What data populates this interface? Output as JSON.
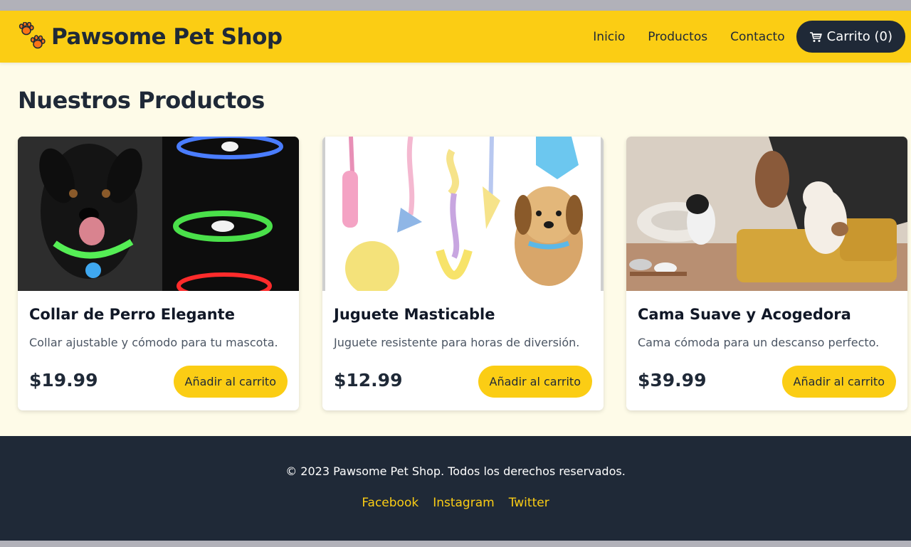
{
  "brand": {
    "name": "Pawsome Pet Shop",
    "icon": "paw-prints-icon"
  },
  "nav": {
    "links": [
      "Inicio",
      "Productos",
      "Contacto"
    ],
    "cart_label": "Carrito (0)",
    "cart_icon": "shopping-cart-icon"
  },
  "main": {
    "title": "Nuestros Productos"
  },
  "products": [
    {
      "name": "Collar de Perro Elegante",
      "description": "Collar ajustable y cómodo para tu mascota.",
      "price": "$19.99",
      "button": "Añadir al carrito"
    },
    {
      "name": "Juguete Masticable",
      "description": "Juguete resistente para horas de diversión.",
      "price": "$12.99",
      "button": "Añadir al carrito"
    },
    {
      "name": "Cama Suave y Acogedora",
      "description": "Cama cómoda para un descanso perfecto.",
      "price": "$39.99",
      "button": "Añadir al carrito"
    }
  ],
  "footer": {
    "copyright": "© 2023 Pawsome Pet Shop. Todos los derechos reservados.",
    "social": [
      "Facebook",
      "Instagram",
      "Twitter"
    ]
  },
  "colors": {
    "accent": "#fbcd14",
    "dark": "#1f2937",
    "background": "#fefbe8"
  }
}
